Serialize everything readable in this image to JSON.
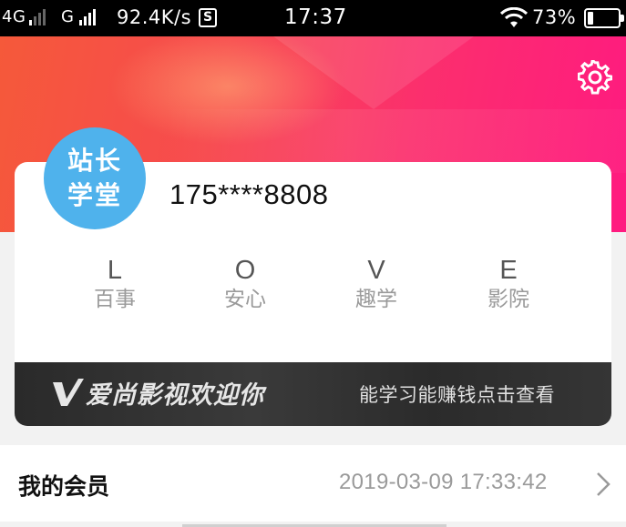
{
  "status_bar": {
    "network_1": "4G",
    "network_2": "G",
    "speed": "92.4K/s",
    "s_badge": "S",
    "time": "17:37",
    "battery": "73%"
  },
  "header": {
    "settings_icon": "gear-icon"
  },
  "profile": {
    "avatar_line1": "站长",
    "avatar_line2": "学堂",
    "phone": "175****8808",
    "love": [
      {
        "letter": "L",
        "word": "百事"
      },
      {
        "letter": "O",
        "word": "安心"
      },
      {
        "letter": "V",
        "word": "趣学"
      },
      {
        "letter": "E",
        "word": "影院"
      }
    ]
  },
  "banner": {
    "welcome": "爱尚影视欢迎你",
    "promo": "能学习能赚钱点击查看",
    "logo_icon": "v-logo-icon"
  },
  "membership": {
    "label": "我的会员",
    "date": "2019-03-09 17:33:42",
    "chevron_icon": "chevron-right-icon"
  }
}
